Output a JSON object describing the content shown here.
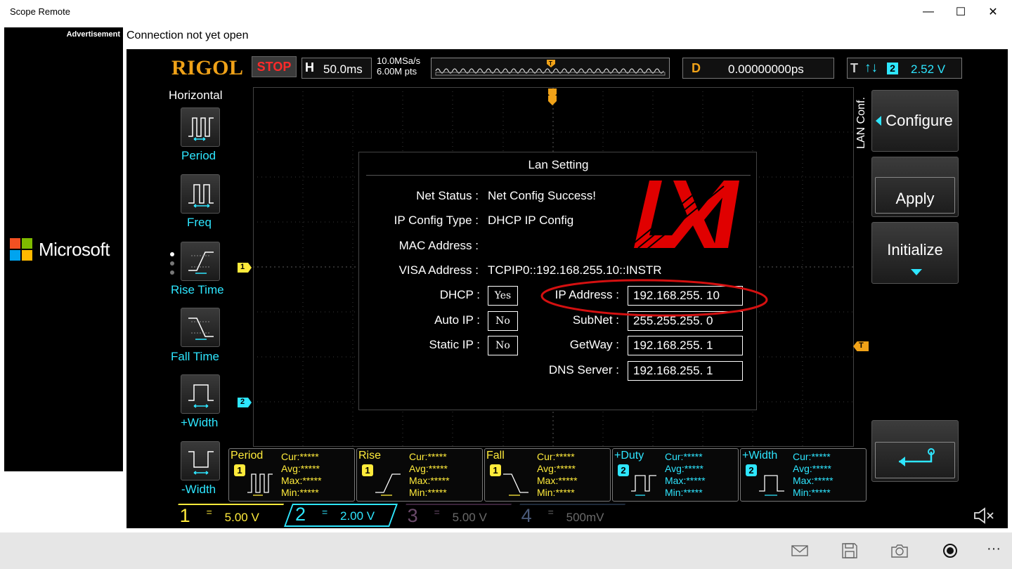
{
  "window": {
    "title": "Scope Remote",
    "controls": {
      "minimize": "—",
      "maximize": "☐",
      "close": "✕"
    }
  },
  "ad": {
    "label": "Advertisement",
    "brand": "Microsoft"
  },
  "connection_status": "Connection not yet open",
  "scope": {
    "brand": "RIGOL",
    "run_state": "STOP",
    "horizontal": {
      "letter": "H",
      "timebase": "50.0ms"
    },
    "sample_rate": "10.0MSa/s",
    "memory_depth": "6.00M pts",
    "delay": {
      "letter": "D",
      "value": "0.00000000ps"
    },
    "trigger": {
      "letter": "T",
      "edge": "↑↓",
      "source": "2",
      "level": "2.52 V"
    },
    "markers": {
      "ch1": "1",
      "ch2": "2",
      "trigger": "T"
    },
    "left_menu": {
      "title": "Horizontal",
      "items": [
        "Period",
        "Freq",
        "Rise Time",
        "Fall Time",
        "+Width",
        "-Width"
      ]
    },
    "lan_dialog": {
      "title": "Lan Setting",
      "net_status_label": "Net Status :",
      "net_status_value": "Net Config Success!",
      "ip_config_type_label": "IP Config Type :",
      "ip_config_type_value": "DHCP IP Config",
      "mac_label": "MAC Address :",
      "visa_label": "VISA Address :",
      "visa_value": "TCPIP0::192.168.255.10::INSTR",
      "dhcp_label": "DHCP :",
      "dhcp_value": "Yes",
      "autoip_label": "Auto IP :",
      "autoip_value": "No",
      "staticip_label": "Static IP :",
      "staticip_value": "No",
      "ip_label": "IP Address :",
      "ip_value": "192.168.255. 10",
      "subnet_label": "SubNet :",
      "subnet_value": "255.255.255. 0",
      "gateway_label": "GetWay :",
      "gateway_value": "192.168.255. 1",
      "dns_label": "DNS Server :",
      "dns_value": "192.168.255. 1"
    },
    "right_menu": {
      "section": "LAN Conf.",
      "configure": "Configure",
      "apply": "Apply",
      "initialize": "Initialize"
    },
    "measurements": [
      {
        "name": "Period",
        "channel": "1",
        "color": "#ffeb3b",
        "cur": "Cur:*****",
        "avg": "Avg:*****",
        "max": "Max:*****",
        "min": "Min:*****"
      },
      {
        "name": "Rise",
        "channel": "1",
        "color": "#ffeb3b",
        "cur": "Cur:*****",
        "avg": "Avg:*****",
        "max": "Max:*****",
        "min": "Min:*****"
      },
      {
        "name": "Fall",
        "channel": "1",
        "color": "#ffeb3b",
        "cur": "Cur:*****",
        "avg": "Avg:*****",
        "max": "Max:*****",
        "min": "Min:*****"
      },
      {
        "name": "+Duty",
        "channel": "2",
        "color": "#2ee6ff",
        "cur": "Cur:*****",
        "avg": "Avg:*****",
        "max": "Max:*****",
        "min": "Min:*****"
      },
      {
        "name": "+Width",
        "channel": "2",
        "color": "#2ee6ff",
        "cur": "Cur:*****",
        "avg": "Avg:*****",
        "max": "Max:*****",
        "min": "Min:*****"
      }
    ],
    "channels": [
      {
        "num": "1",
        "coupling": "=",
        "scale": "5.00 V",
        "color": "#ffeb3b"
      },
      {
        "num": "2",
        "coupling": "=",
        "scale": "2.00 V",
        "color": "#2ee6ff"
      },
      {
        "num": "3",
        "coupling": "=",
        "scale": "5.00 V",
        "color": "#6a3a6a"
      },
      {
        "num": "4",
        "coupling": "=",
        "scale": "500mV",
        "color": "#334a6a"
      }
    ]
  },
  "appbar": {
    "icons": [
      "mail-icon",
      "save-icon",
      "camera-icon",
      "record-icon",
      "more-icon"
    ],
    "more": "···"
  }
}
